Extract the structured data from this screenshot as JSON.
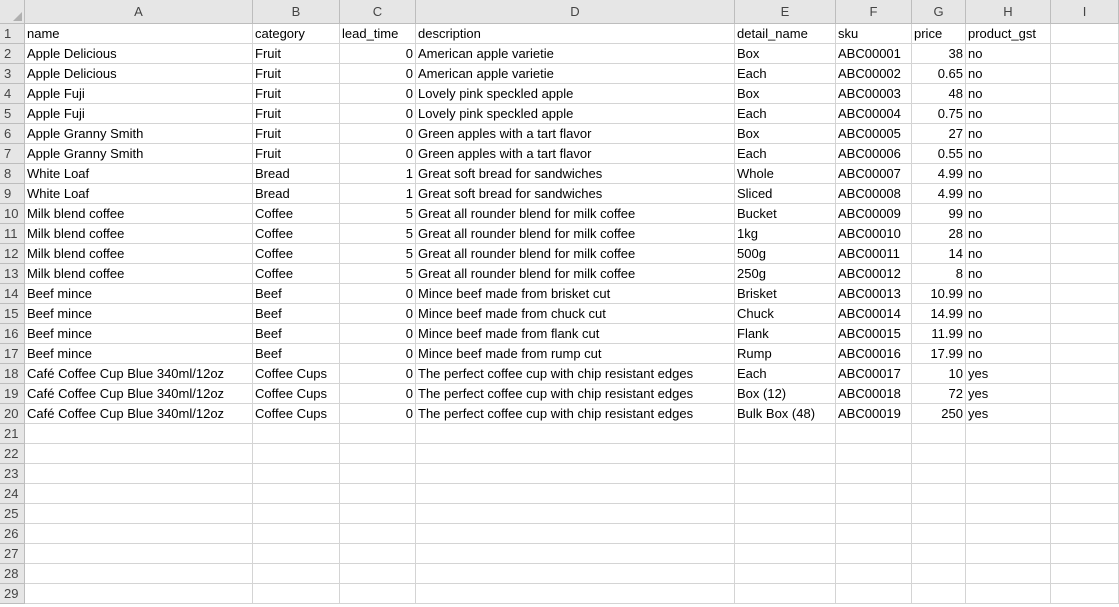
{
  "columns": [
    "A",
    "B",
    "C",
    "D",
    "E",
    "F",
    "G",
    "H",
    "I"
  ],
  "row_numbers": [
    "1",
    "2",
    "3",
    "4",
    "5",
    "6",
    "7",
    "8",
    "9",
    "10",
    "11",
    "12",
    "13",
    "14",
    "15",
    "16",
    "17",
    "18",
    "19",
    "20",
    "21",
    "22",
    "23",
    "24",
    "25",
    "26",
    "27",
    "28",
    "29"
  ],
  "header": [
    "name",
    "category",
    "lead_time",
    "description",
    "detail_name",
    "sku",
    "price",
    "product_gst",
    ""
  ],
  "rows": [
    [
      "Apple Delicious",
      "Fruit",
      "0",
      "American apple varietie",
      "Box",
      "ABC00001",
      "38",
      "no",
      ""
    ],
    [
      "Apple Delicious",
      "Fruit",
      "0",
      "American apple varietie",
      "Each",
      "ABC00002",
      "0.65",
      "no",
      ""
    ],
    [
      "Apple Fuji",
      "Fruit",
      "0",
      "Lovely pink speckled apple",
      "Box",
      "ABC00003",
      "48",
      "no",
      ""
    ],
    [
      "Apple Fuji",
      "Fruit",
      "0",
      "Lovely pink speckled apple",
      "Each",
      "ABC00004",
      "0.75",
      "no",
      ""
    ],
    [
      "Apple Granny Smith",
      "Fruit",
      "0",
      "Green apples with a tart flavor",
      "Box",
      "ABC00005",
      "27",
      "no",
      ""
    ],
    [
      "Apple Granny Smith",
      "Fruit",
      "0",
      "Green apples with a tart flavor",
      "Each",
      "ABC00006",
      "0.55",
      "no",
      ""
    ],
    [
      "White Loaf",
      "Bread",
      "1",
      "Great soft bread for sandwiches",
      "Whole",
      "ABC00007",
      "4.99",
      "no",
      ""
    ],
    [
      "White Loaf",
      "Bread",
      "1",
      "Great soft bread for sandwiches",
      "Sliced",
      "ABC00008",
      "4.99",
      "no",
      ""
    ],
    [
      "Milk blend coffee",
      "Coffee",
      "5",
      "Great all rounder blend for milk coffee",
      "Bucket",
      "ABC00009",
      "99",
      "no",
      ""
    ],
    [
      "Milk blend coffee",
      "Coffee",
      "5",
      "Great all rounder blend for milk coffee",
      "1kg",
      "ABC00010",
      "28",
      "no",
      ""
    ],
    [
      "Milk blend coffee",
      "Coffee",
      "5",
      "Great all rounder blend for milk coffee",
      "500g",
      "ABC00011",
      "14",
      "no",
      ""
    ],
    [
      "Milk blend coffee",
      "Coffee",
      "5",
      "Great all rounder blend for milk coffee",
      "250g",
      "ABC00012",
      "8",
      "no",
      ""
    ],
    [
      "Beef mince",
      "Beef",
      "0",
      "Mince beef made from brisket cut",
      "Brisket",
      "ABC00013",
      "10.99",
      "no",
      ""
    ],
    [
      "Beef mince",
      "Beef",
      "0",
      "Mince beef made from chuck cut",
      "Chuck",
      "ABC00014",
      "14.99",
      "no",
      ""
    ],
    [
      "Beef mince",
      "Beef",
      "0",
      "Mince beef made from flank cut",
      "Flank",
      "ABC00015",
      "11.99",
      "no",
      ""
    ],
    [
      "Beef mince",
      "Beef",
      "0",
      "Mince beef made from rump cut",
      "Rump",
      "ABC00016",
      "17.99",
      "no",
      ""
    ],
    [
      "Café Coffee Cup Blue 340ml/12oz",
      "Coffee Cups",
      "0",
      "The perfect coffee cup with chip resistant edges",
      "Each",
      "ABC00017",
      "10",
      "yes",
      ""
    ],
    [
      "Café Coffee Cup Blue 340ml/12oz",
      "Coffee Cups",
      "0",
      "The perfect coffee cup with chip resistant edges",
      "Box (12)",
      "ABC00018",
      "72",
      "yes",
      ""
    ],
    [
      "Café Coffee Cup Blue 340ml/12oz",
      "Coffee Cups",
      "0",
      "The perfect coffee cup with chip resistant edges",
      "Bulk Box (48)",
      "ABC00019",
      "250",
      "yes",
      ""
    ]
  ],
  "numeric_columns": [
    "C",
    "G"
  ],
  "colors": {
    "header_bg": "#e6e6e6",
    "gridline": "#d4d4d4",
    "header_border": "#bdbdbd"
  }
}
